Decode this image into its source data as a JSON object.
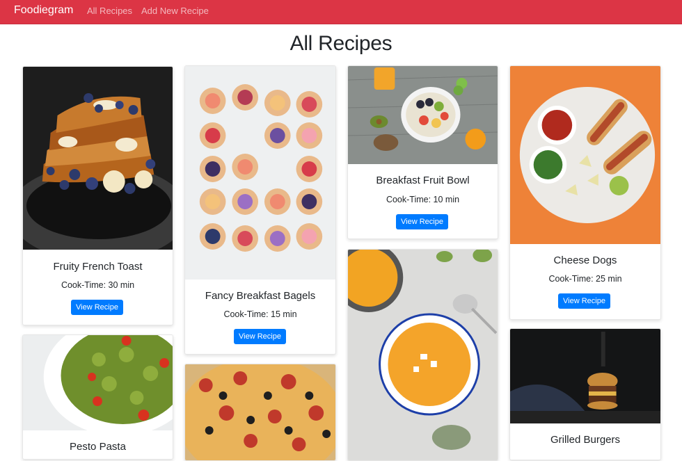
{
  "nav": {
    "brand": "Foodiegram",
    "links": [
      "All Recipes",
      "Add New Recipe"
    ]
  },
  "page": {
    "title": "All Recipes"
  },
  "recipes": [
    {
      "name": "Fruity French Toast",
      "cook_time": "Cook-Time: 30 min",
      "button": "View Recipe"
    },
    {
      "name": "Fancy Breakfast Bagels",
      "cook_time": "Cook-Time: 15 min",
      "button": "View Recipe"
    },
    {
      "name": "Breakfast Fruit Bowl",
      "cook_time": "Cook-Time: 10 min",
      "button": "View Recipe"
    },
    {
      "name": "Cheese Dogs",
      "cook_time": "Cook-Time: 25 min",
      "button": "View Recipe"
    },
    {
      "name": "Pesto Pasta"
    },
    {
      "name": "Grilled Burgers"
    }
  ],
  "colors": {
    "navbar": "#dc3545",
    "button": "#007bff"
  }
}
